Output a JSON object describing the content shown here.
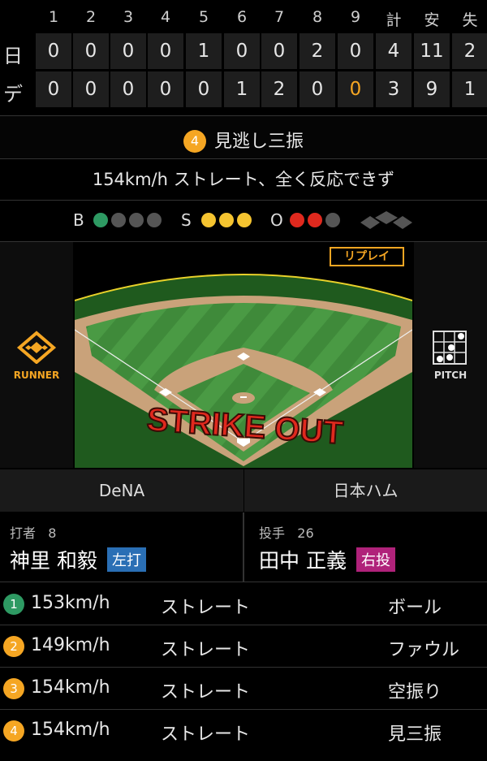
{
  "scoreboard": {
    "headers": [
      "1",
      "2",
      "3",
      "4",
      "5",
      "6",
      "7",
      "8",
      "9",
      "計",
      "安",
      "失"
    ],
    "teams": [
      {
        "abbr": "日",
        "cells": [
          "0",
          "0",
          "0",
          "0",
          "1",
          "0",
          "0",
          "2",
          "0",
          "4",
          "11",
          "2"
        ]
      },
      {
        "abbr": "デ",
        "cells": [
          "0",
          "0",
          "0",
          "0",
          "0",
          "1",
          "2",
          "0",
          "0",
          "3",
          "9",
          "1"
        ]
      }
    ]
  },
  "result": {
    "number": "4",
    "label": "見逃し三振",
    "badge_color": "#f5a623"
  },
  "description": "154km/h ストレート、全く反応できず",
  "count": {
    "b_label": "B",
    "s_label": "S",
    "o_label": "O",
    "balls": 1,
    "strikes": 3,
    "outs": 2
  },
  "field": {
    "replay_label": "リプレイ",
    "strike_out_text": "STRIKE OUT",
    "runner_label": "RUNNER",
    "pitch_label": "PITCH"
  },
  "teams": {
    "home": "DeNA",
    "away": "日本ハム"
  },
  "batter": {
    "role": "打者",
    "number": "8",
    "name": "神里 和毅",
    "hand": "左打",
    "hand_color": "#2a6fb5"
  },
  "pitcher": {
    "role": "投手",
    "number": "26",
    "name": "田中 正義",
    "hand": "右投",
    "hand_color": "#b0227a"
  },
  "pitches": [
    {
      "n": "1",
      "speed": "153km/h",
      "type": "ストレート",
      "result": "ボール",
      "color": "#2e9a63"
    },
    {
      "n": "2",
      "speed": "149km/h",
      "type": "ストレート",
      "result": "ファウル",
      "color": "#f5a623"
    },
    {
      "n": "3",
      "speed": "154km/h",
      "type": "ストレート",
      "result": "空振り",
      "color": "#f5a623"
    },
    {
      "n": "4",
      "speed": "154km/h",
      "type": "ストレート",
      "result": "見三振",
      "color": "#f5a623"
    }
  ],
  "colors": {
    "ball": "#2e9a63",
    "strike": "#f5c430",
    "out": "#e0291e",
    "empty": "#555555",
    "accent": "#f5a623"
  }
}
